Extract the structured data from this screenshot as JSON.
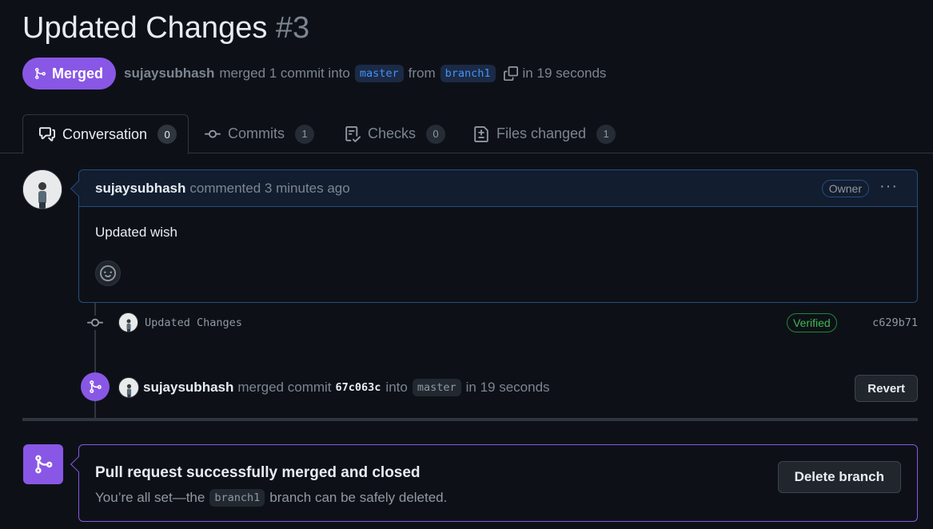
{
  "pr": {
    "title": "Updated Changes",
    "number": "#3",
    "state": "Merged",
    "author": "sujaysubhash",
    "merged_text": "merged 1 commit into",
    "base_branch": "master",
    "from_text": "from",
    "head_branch": "branch1",
    "time": "in 19 seconds"
  },
  "tabs": [
    {
      "label": "Conversation",
      "count": "0"
    },
    {
      "label": "Commits",
      "count": "1"
    },
    {
      "label": "Checks",
      "count": "0"
    },
    {
      "label": "Files changed",
      "count": "1"
    }
  ],
  "comment": {
    "author": "sujaysubhash",
    "action": "commented 3 minutes ago",
    "badge": "Owner",
    "more": "···",
    "body": "Updated wish"
  },
  "commit": {
    "message": "Updated Changes",
    "verified": "Verified",
    "sha": "c629b71"
  },
  "merge_event": {
    "author": "sujaysubhash",
    "text1": "merged commit",
    "sha": "67c063c",
    "text2": "into",
    "branch": "master",
    "time": "in 19 seconds",
    "revert_label": "Revert"
  },
  "merged_box": {
    "title": "Pull request successfully merged and closed",
    "sub_prefix": "You’re all set—the",
    "branch": "branch1",
    "sub_suffix": "branch can be safely deleted.",
    "delete_label": "Delete branch"
  },
  "colors": {
    "background": "#0d1117",
    "merged_purple": "#8957e5",
    "verified_green": "#3fb950",
    "link_blue": "#4493f8"
  }
}
